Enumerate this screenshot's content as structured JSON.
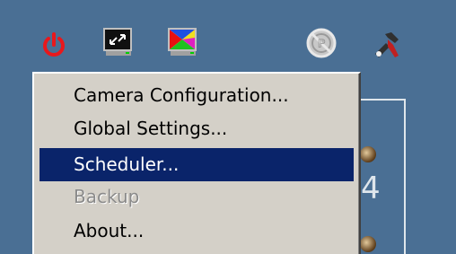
{
  "toolbar": {
    "icons": [
      "power-icon",
      "camera-monitor-icon",
      "color-monitor-icon",
      "no-channel-icon",
      "tools-icon"
    ]
  },
  "background": {
    "side_digit": "4"
  },
  "menu": {
    "items": [
      {
        "label": "Camera Configuration...",
        "state": "normal"
      },
      {
        "label": "Global Settings...",
        "state": "normal"
      },
      {
        "label": "Scheduler...",
        "state": "selected"
      },
      {
        "label": "Backup",
        "state": "disabled"
      },
      {
        "label": "About...",
        "state": "normal"
      }
    ]
  },
  "colors": {
    "background": "#4a6f94",
    "menu_bg": "#d4d0c8",
    "highlight": "#0a246a",
    "power_red": "#e8181c"
  }
}
